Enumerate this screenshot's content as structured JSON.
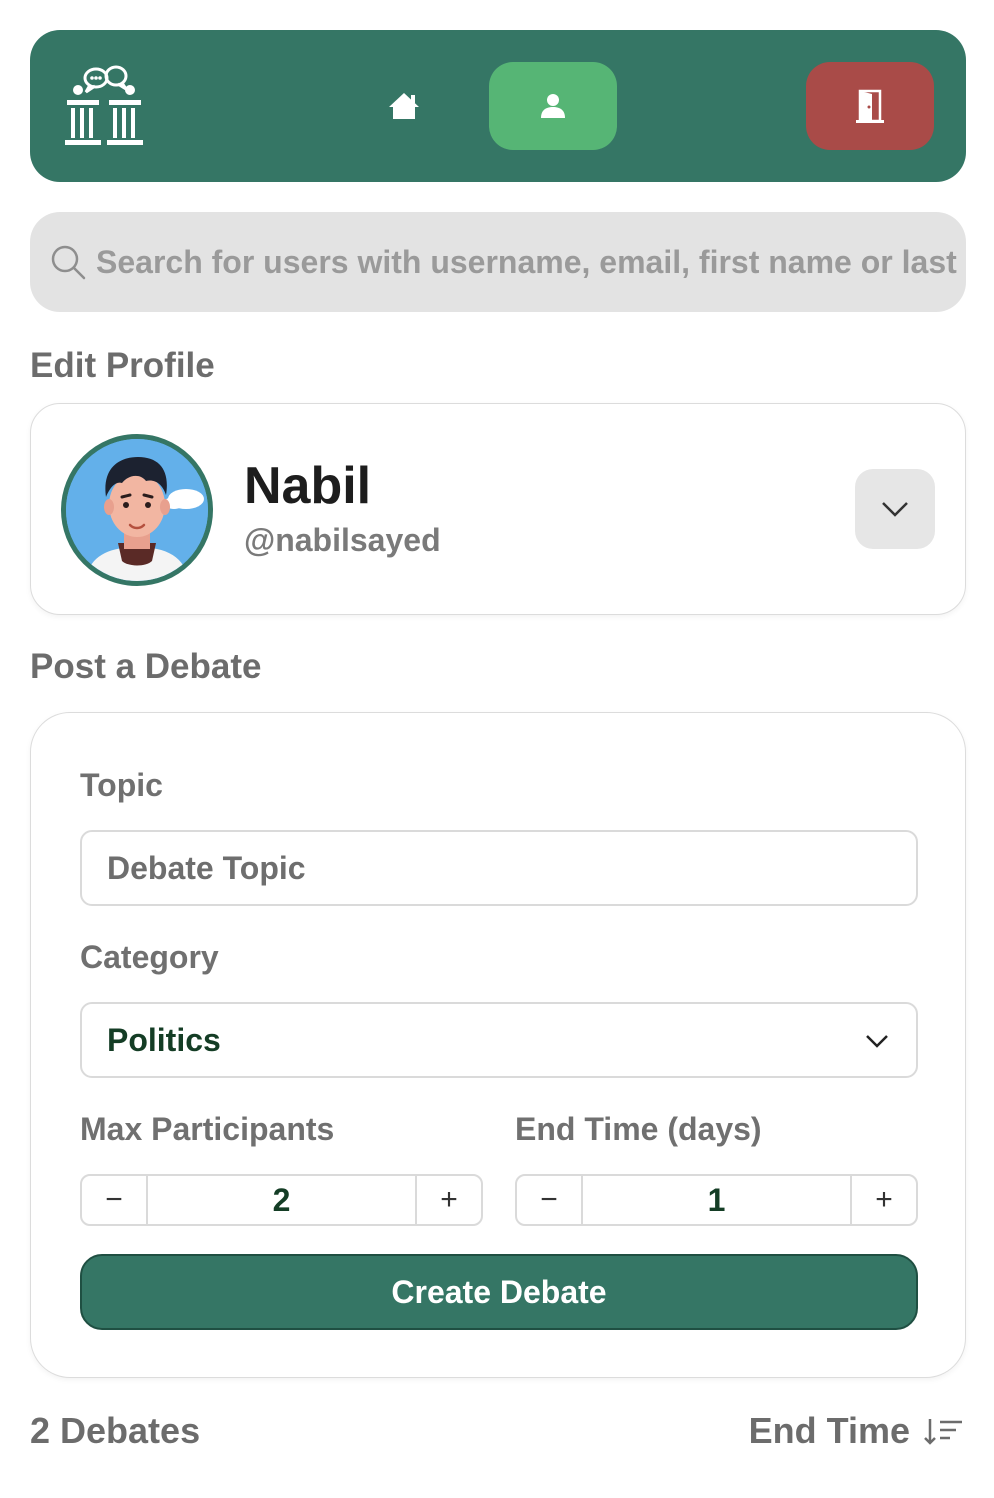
{
  "colors": {
    "brand": "#357665",
    "profile_active": "#56b575",
    "logout": "#a94b48",
    "search_bg": "#e3e3e3",
    "muted_text": "#6c6c6c",
    "value_text": "#143d25"
  },
  "nav": {
    "logo_icon": "debate-podium-logo-icon",
    "home_icon": "home-icon",
    "profile_icon": "user-icon",
    "logout_icon": "door-exit-icon"
  },
  "search": {
    "placeholder": "Search for users with username, email, first name or last name"
  },
  "profile_section": {
    "title": "Edit Profile",
    "name": "Nabil",
    "username": "@nabilsayed",
    "toggle_icon": "chevron-down-icon"
  },
  "debate_form": {
    "title": "Post a Debate",
    "topic_label": "Topic",
    "topic_placeholder": "Debate Topic",
    "topic_value": "",
    "category_label": "Category",
    "category_value": "Politics",
    "max_participants_label": "Max Participants",
    "max_participants_value": "2",
    "end_time_label": "End Time (days)",
    "end_time_value": "1",
    "minus": "−",
    "plus": "+",
    "submit_label": "Create Debate"
  },
  "debates_list": {
    "count_label": "2 Debates",
    "sort_label": "End Time",
    "sort_icon": "sort-descending-icon"
  }
}
